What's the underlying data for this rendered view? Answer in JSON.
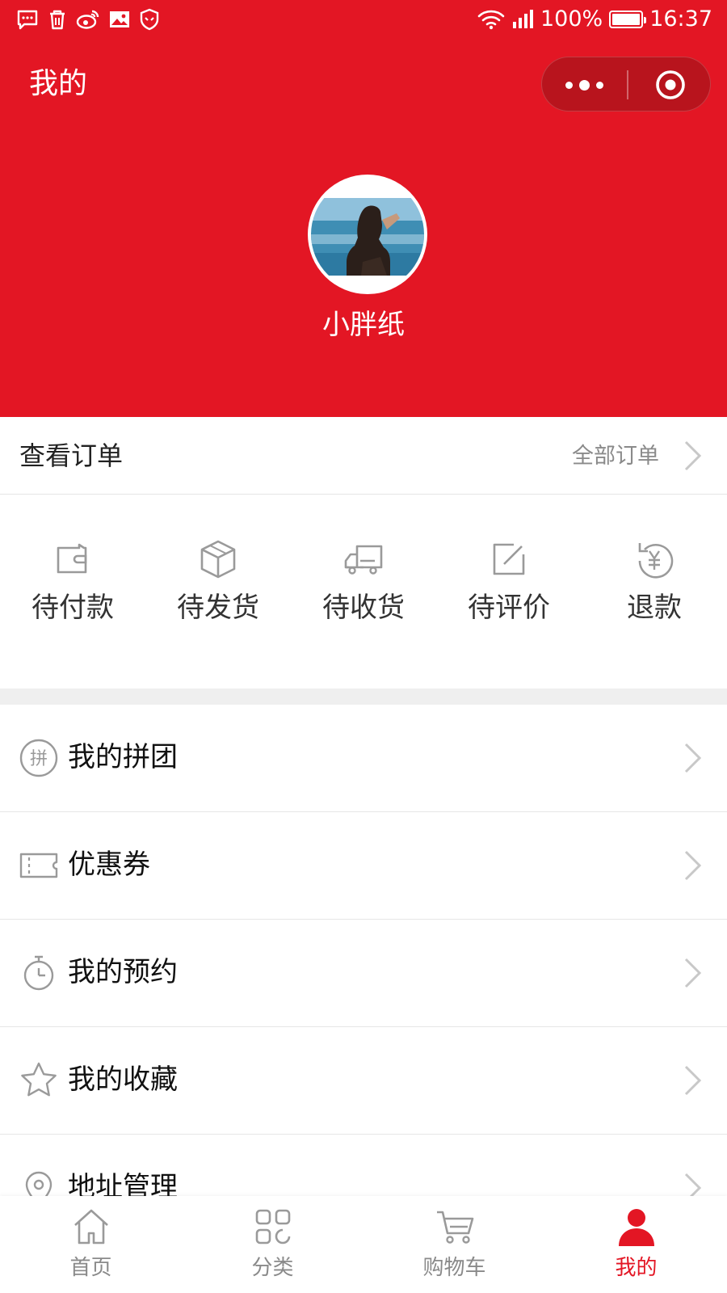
{
  "status_bar": {
    "battery": "100%",
    "time": "16:37",
    "left_icons": [
      "message-icon",
      "trash-icon",
      "weibo-icon",
      "image-icon",
      "shield-icon"
    ]
  },
  "nav": {
    "title": "我的"
  },
  "profile": {
    "username": "小胖纸"
  },
  "orders": {
    "title": "查看订单",
    "all_label": "全部订单",
    "items": [
      {
        "label": "待付款",
        "icon": "wallet-icon"
      },
      {
        "label": "待发货",
        "icon": "box-icon"
      },
      {
        "label": "待收货",
        "icon": "truck-icon"
      },
      {
        "label": "待评价",
        "icon": "edit-icon"
      },
      {
        "label": "退款",
        "icon": "refund-icon"
      }
    ]
  },
  "menu": {
    "items": [
      {
        "label": "我的拼团",
        "icon": "group-buy-icon",
        "icon_text": "拼"
      },
      {
        "label": "优惠券",
        "icon": "coupon-icon"
      },
      {
        "label": "我的预约",
        "icon": "stopwatch-icon"
      },
      {
        "label": "我的收藏",
        "icon": "star-icon"
      },
      {
        "label": "地址管理",
        "icon": "location-pin-icon"
      }
    ]
  },
  "tabbar": {
    "items": [
      {
        "label": "首页",
        "icon": "home-icon",
        "active": false
      },
      {
        "label": "分类",
        "icon": "category-icon",
        "active": false
      },
      {
        "label": "购物车",
        "icon": "cart-icon",
        "active": false
      },
      {
        "label": "我的",
        "icon": "user-icon",
        "active": true
      }
    ]
  },
  "colors": {
    "brand": "#E31624",
    "capsule": "#B8141D",
    "muted_text": "#8a8a8a",
    "separator": "#efefef",
    "icon_gray": "#9a9a9a"
  }
}
